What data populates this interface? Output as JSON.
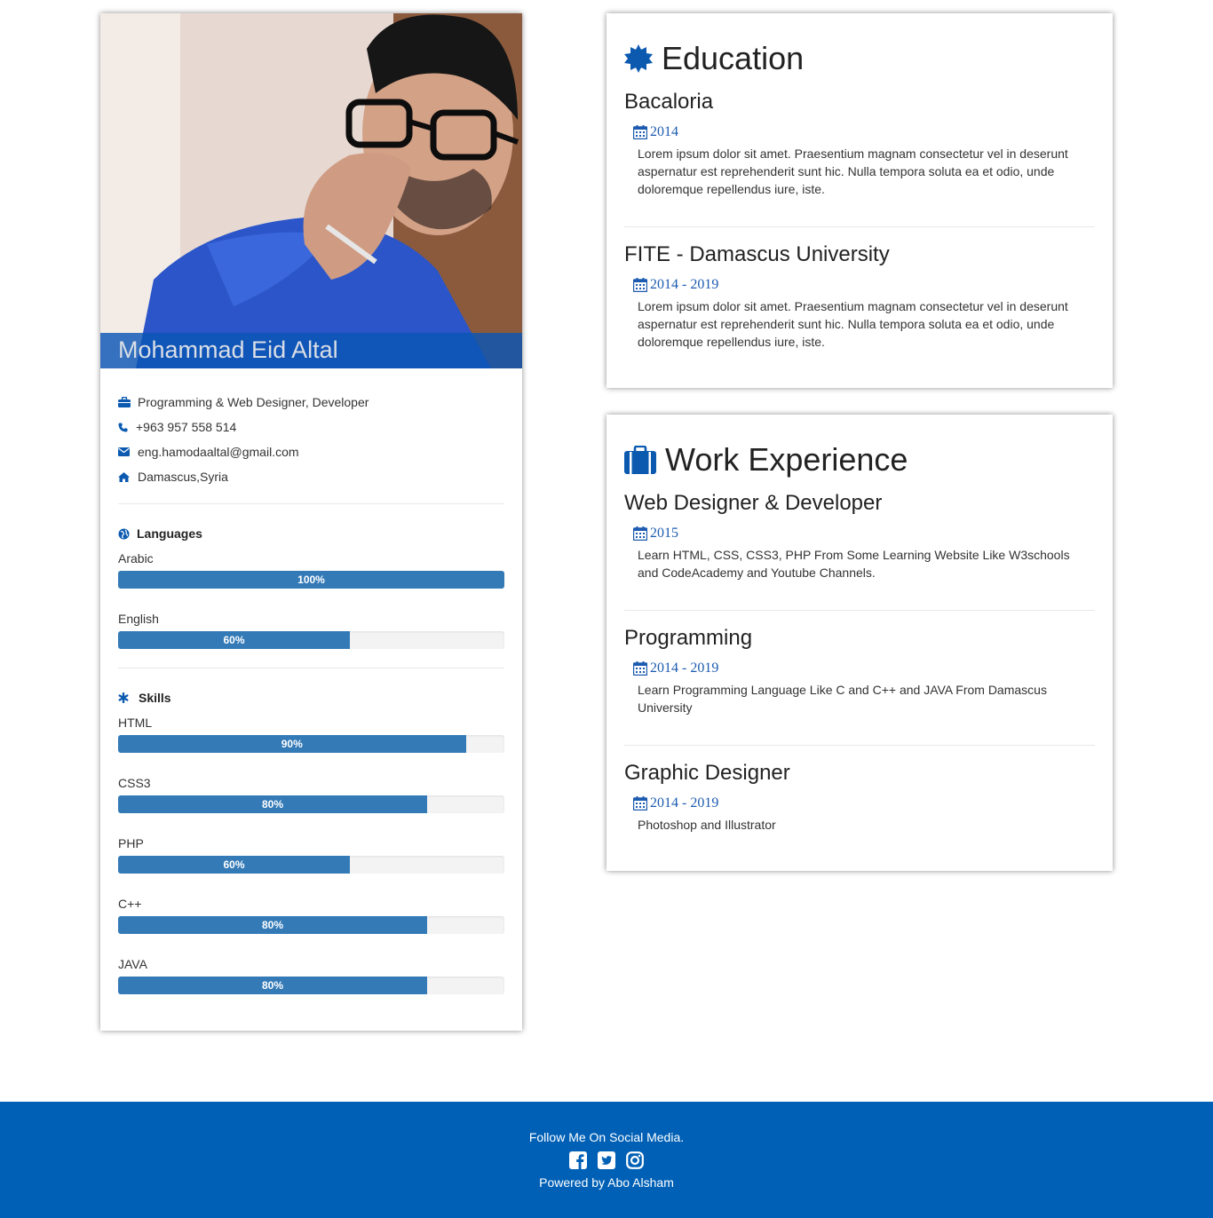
{
  "profile": {
    "name": "Mohammad Eid Altal",
    "photo_alt": "profile-photo",
    "info": [
      {
        "icon": "briefcase-icon",
        "text": "Programming & Web Designer, Developer"
      },
      {
        "icon": "phone-icon",
        "text": "+963 957 558 514"
      },
      {
        "icon": "envelope-icon",
        "text": "eng.hamodaaltal@gmail.com"
      },
      {
        "icon": "home-icon",
        "text": "Damascus,Syria"
      }
    ],
    "languages_title": "Languages",
    "languages": [
      {
        "name": "Arabic",
        "level": 100,
        "label": "100%"
      },
      {
        "name": "English",
        "level": 60,
        "label": "60%"
      }
    ],
    "skills_title": "Skills",
    "skills": [
      {
        "name": "HTML",
        "level": 90,
        "label": "90%"
      },
      {
        "name": "CSS3",
        "level": 80,
        "label": "80%"
      },
      {
        "name": "PHP",
        "level": 60,
        "label": "60%"
      },
      {
        "name": "C++",
        "level": 80,
        "label": "80%"
      },
      {
        "name": "JAVA",
        "level": 80,
        "label": "80%"
      }
    ]
  },
  "education": {
    "title": "Education",
    "entries": [
      {
        "title": "Bacaloria",
        "date": "2014",
        "desc": "Lorem ipsum dolor sit amet. Praesentium magnam consectetur vel in deserunt aspernatur est reprehenderit sunt hic. Nulla tempora soluta ea et odio, unde doloremque repellendus iure, iste."
      },
      {
        "title": "FITE - Damascus University",
        "date": "2014 - 2019",
        "desc": "Lorem ipsum dolor sit amet. Praesentium magnam consectetur vel in deserunt aspernatur est reprehenderit sunt hic. Nulla tempora soluta ea et odio, unde doloremque repellendus iure, iste."
      }
    ]
  },
  "work": {
    "title": "Work Experience",
    "entries": [
      {
        "title": "Web Designer & Developer",
        "date": "2015",
        "desc": "Learn HTML, CSS, CSS3, PHP From Some Learning Website Like W3schools and CodeAcademy and Youtube Channels."
      },
      {
        "title": "Programming",
        "date": "2014 - 2019",
        "desc": "Learn Programming Language Like C and C++ and JAVA From Damascus University"
      },
      {
        "title": "Graphic Designer",
        "date": "2014 - 2019",
        "desc": "Photoshop and Illustrator"
      }
    ]
  },
  "footer": {
    "follow": "Follow Me On Social Media.",
    "socials": [
      "facebook-icon",
      "twitter-icon",
      "instagram-icon"
    ],
    "powered": "Powered by Abo Alsham"
  },
  "colors": {
    "accent": "#337ab7",
    "brand": "#0060b6",
    "date": "#1c5bb0"
  }
}
